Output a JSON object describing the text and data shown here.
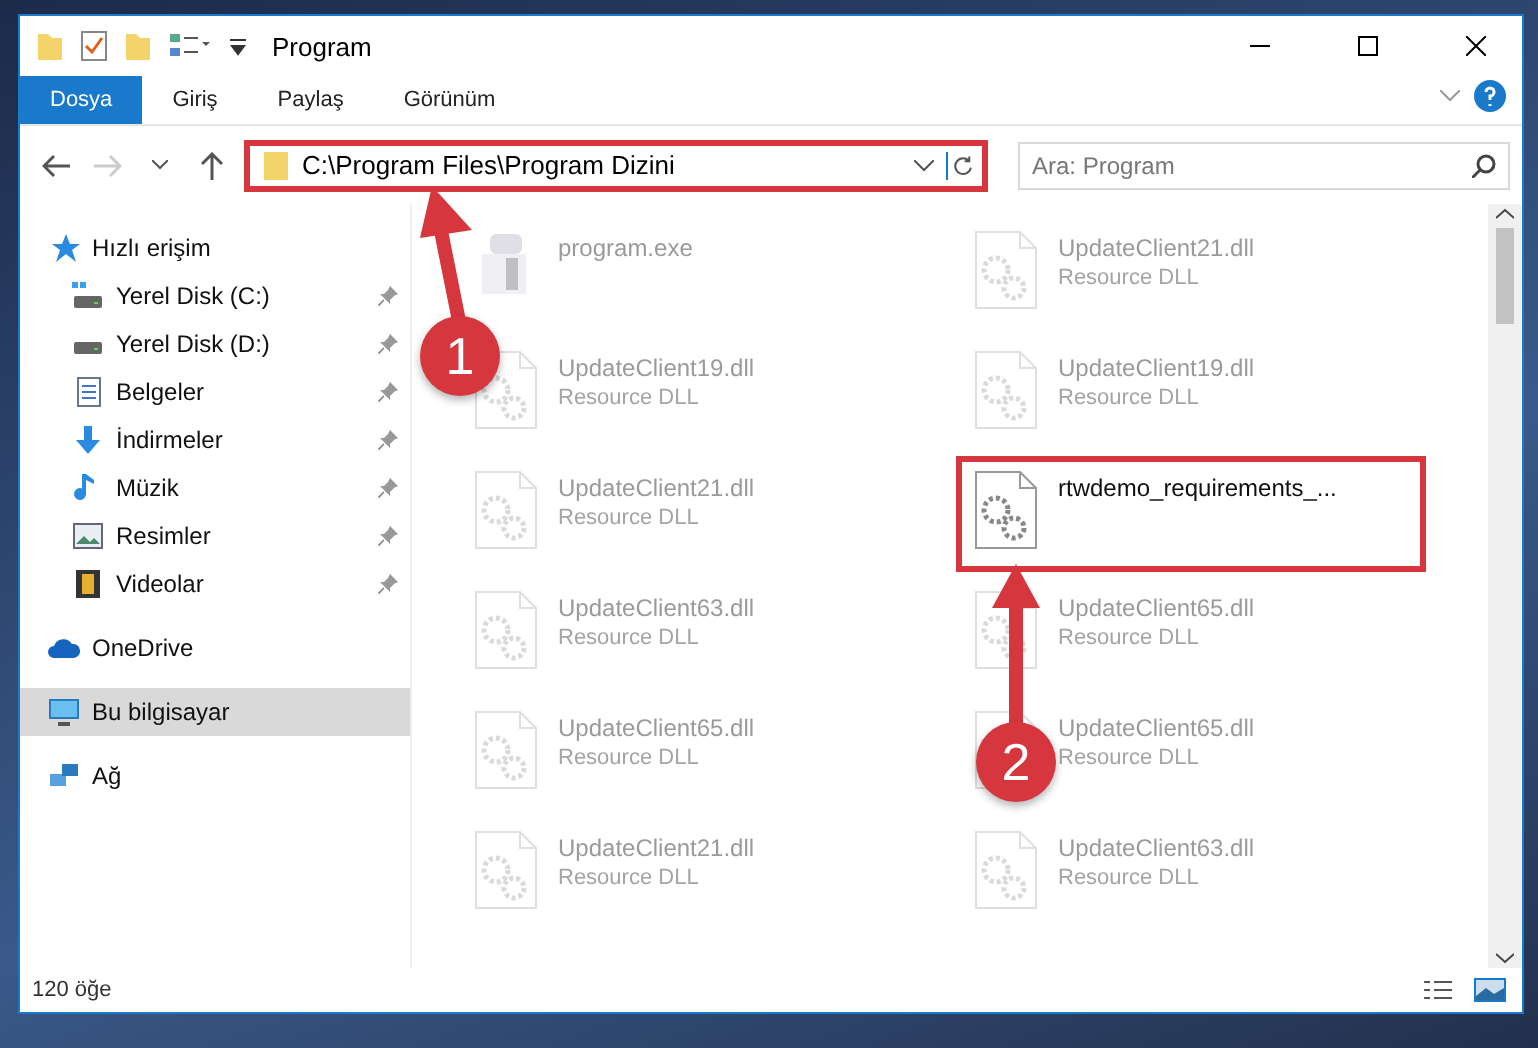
{
  "window": {
    "title": "Program"
  },
  "ribbon_tabs": [
    {
      "label": "Dosya",
      "selected": true
    },
    {
      "label": "Giriş",
      "selected": false
    },
    {
      "label": "Paylaş",
      "selected": false
    },
    {
      "label": "Görünüm",
      "selected": false
    }
  ],
  "address": {
    "path": "C:\\Program Files\\Program Dizini",
    "outlined": true
  },
  "search": {
    "placeholder": "Ara: Program"
  },
  "sidebar": [
    {
      "label": "Hızlı erişim",
      "kind": "star",
      "selected": false,
      "children": [
        {
          "label": "Yerel Disk (C:)",
          "kind": "disk-c",
          "pinned": true,
          "selected": false
        },
        {
          "label": "Yerel Disk (D:)",
          "kind": "disk",
          "pinned": true,
          "selected": false
        },
        {
          "label": "Belgeler",
          "kind": "doc",
          "pinned": true,
          "selected": false
        },
        {
          "label": "İndirmeler",
          "kind": "download",
          "pinned": true,
          "selected": false
        },
        {
          "label": "Müzik",
          "kind": "music",
          "pinned": true,
          "selected": false
        },
        {
          "label": "Resimler",
          "kind": "picture",
          "pinned": true,
          "selected": false
        },
        {
          "label": "Videolar",
          "kind": "video",
          "pinned": true,
          "selected": false
        }
      ]
    },
    {
      "label": "OneDrive",
      "kind": "cloud",
      "selected": false
    },
    {
      "label": "Bu bilgisayar",
      "kind": "pc",
      "selected": true
    },
    {
      "label": "Ağ",
      "kind": "network",
      "selected": false
    }
  ],
  "files": [
    {
      "name": "program.exe",
      "kind": "exe",
      "dimmed": true,
      "outlined": false
    },
    {
      "name": "UpdateClient21.dll",
      "type": "Resource DLL",
      "kind": "dll",
      "dimmed": true,
      "outlined": false
    },
    {
      "name": "UpdateClient19.dll",
      "type": "Resource DLL",
      "kind": "dll",
      "dimmed": true,
      "outlined": false
    },
    {
      "name": "UpdateClient19.dll",
      "type": "Resource DLL",
      "kind": "dll",
      "dimmed": true,
      "outlined": false
    },
    {
      "name": "UpdateClient21.dll",
      "type": "Resource DLL",
      "kind": "dll",
      "dimmed": true,
      "outlined": false
    },
    {
      "name": "rtwdemo_requirements_...",
      "kind": "dll",
      "dimmed": false,
      "outlined": true
    },
    {
      "name": "UpdateClient63.dll",
      "type": "Resource DLL",
      "kind": "dll",
      "dimmed": true,
      "outlined": false
    },
    {
      "name": "UpdateClient65.dll",
      "type": "Resource DLL",
      "kind": "dll",
      "dimmed": true,
      "outlined": false
    },
    {
      "name": "UpdateClient65.dll",
      "type": "Resource DLL",
      "kind": "dll",
      "dimmed": true,
      "outlined": false
    },
    {
      "name": "UpdateClient65.dll",
      "type": "Resource DLL",
      "kind": "dll",
      "dimmed": true,
      "outlined": false
    },
    {
      "name": "UpdateClient21.dll",
      "type": "Resource DLL",
      "kind": "dll",
      "dimmed": true,
      "outlined": false
    },
    {
      "name": "UpdateClient63.dll",
      "type": "Resource DLL",
      "kind": "dll",
      "dimmed": true,
      "outlined": false
    }
  ],
  "status_bar": {
    "count": "120 öğe"
  },
  "annotations": [
    {
      "number": "1"
    },
    {
      "number": "2"
    }
  ]
}
